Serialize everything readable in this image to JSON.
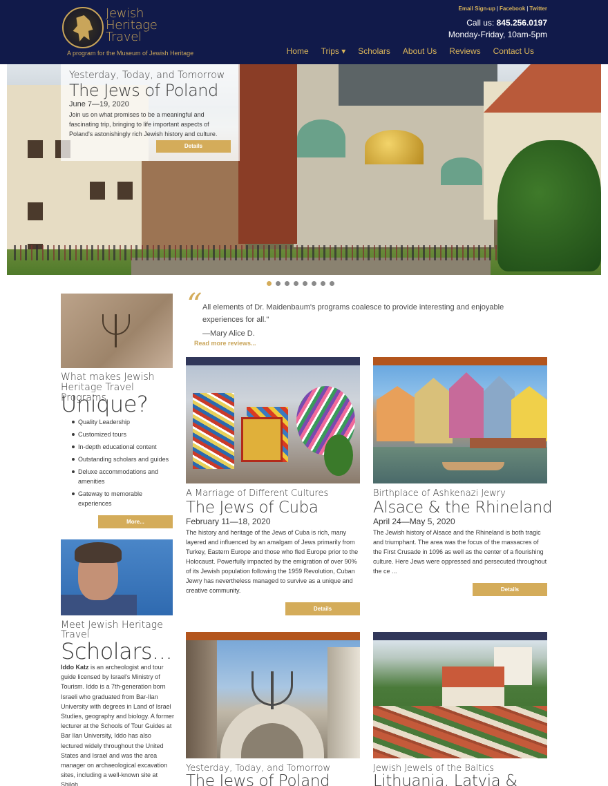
{
  "header": {
    "logo_lines": [
      "Jewish",
      "Heritage",
      "Travel"
    ],
    "tagline": "A program for the Museum of Jewish Heritage",
    "top_links": [
      "Email Sign-up",
      "Facebook",
      "Twitter"
    ],
    "call_label": "Call us:",
    "phone": "845.256.0197",
    "hours": "Monday-Friday, 10am-5pm",
    "nav": [
      "Home",
      "Trips ▾",
      "Scholars",
      "About Us",
      "Reviews",
      "Contact Us"
    ]
  },
  "hero": {
    "subtitle": "Yesterday, Today, and Tomorrow",
    "title": "The Jews of Poland",
    "date": "June 7—19, 2020",
    "description": "Join us on what promises to be a meaningful and fascinating trip, bringing to life important aspects of Poland's astonishingly rich Jewish history and culture.",
    "button": "Details",
    "slides": 8,
    "active_slide": 1
  },
  "review": {
    "quote_mark": "“",
    "text": "All elements of Dr. Maidenbaum's programs coalesce to provide interesting and enjoyable experiences for all.\"",
    "author": "—Mary Alice D.",
    "link": "Read more reviews..."
  },
  "unique": {
    "subtitle": "What makes Jewish Heritage Travel Programs",
    "title": "Unique?",
    "items": [
      "Quality Leadership",
      "Customized tours",
      "In-depth educational content",
      "Outstanding scholars and guides",
      "Deluxe accommodations and amenities",
      "Gateway to memorable experiences"
    ],
    "button": "More..."
  },
  "scholars": {
    "subtitle": "Meet Jewish Heritage Travel",
    "title": "Scholars...",
    "name": "Iddo Katz",
    "bio": " is an archeologist and tour guide licensed by Israel's Ministry of Tourism. Iddo is a 7th-generation born Israeli who graduated from Bar-Ilan University with degrees in Land of Israel Studies, geography and biology. A former lecturer at the Schools of Tour Guides at Bar Ilan University, Iddo has also lectured widely throughout the United States and Israel and was the area manager on archaeological excavation sites, including a well-known site at Shiloh."
  },
  "trips": [
    {
      "subtitle": "A Marriage of Different Cultures",
      "title": "The Jews of Cuba",
      "date": "February 11—18, 2020",
      "description": "The history and heritage of the Jews of Cuba is rich, many layered and influenced by an amalgam of Jews primarily from Turkey, Eastern Europe and those who fled Europe prior to the Holocaust. Powerfully impacted by the emigration of over 90% of its Jewish population following the 1959 Revolution, Cuban Jewry has nevertheless managed to survive as a unique and creative community.",
      "button": "Details"
    },
    {
      "subtitle": "Birthplace of Ashkenazi Jewry",
      "title": "Alsace & the Rhineland",
      "date": "April 24—May 5, 2020",
      "description": "The Jewish history of Alsace and the Rhineland is both tragic and triumphant. The area was the focus of the massacres of the First Crusade in 1096 as well as the center of a flourishing culture. Here Jews were oppressed and persecuted throughout the ce ...",
      "button": "Details"
    },
    {
      "subtitle": "Yesterday, Today, and Tomorrow",
      "title": "The Jews of Poland"
    },
    {
      "subtitle": "Jewish Jewels of the Baltics",
      "title": "Lithuania, Latvia &"
    }
  ],
  "colors": {
    "navy": "#111a4a",
    "gold": "#d4ac5a",
    "orange_bar": "#b3551d",
    "navy_bar": "#31375a"
  }
}
